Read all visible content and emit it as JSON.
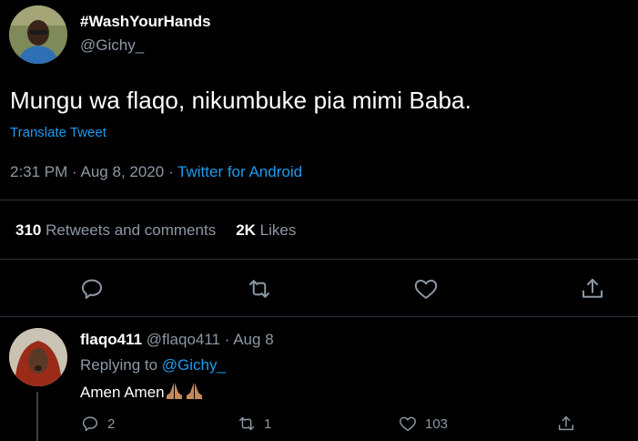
{
  "tweet": {
    "display_name": "#WashYourHands",
    "handle": "@Gichy_",
    "text": "Mungu wa flaqo, nikumbuke pia mimi Baba.",
    "translate_label": "Translate Tweet",
    "time": "2:31 PM",
    "date": "Aug 8, 2020",
    "separator": "·",
    "source": "Twitter for Android",
    "retweets_count": "310",
    "retweets_label": "Retweets and comments",
    "likes_count": "2K",
    "likes_label": "Likes"
  },
  "actions": {
    "reply_icon": "reply-icon",
    "retweet_icon": "retweet-icon",
    "like_icon": "heart-icon",
    "share_icon": "share-icon"
  },
  "reply": {
    "display_name": "flaqo411",
    "handle": "@flaqo411",
    "separator": "·",
    "date": "Aug 8",
    "replying_to_label": "Replying to",
    "replying_to_handle": "@Gichy_",
    "text": "Amen Amen",
    "emoji": "🙏🏽🙏🏽",
    "reply_count": "2",
    "retweet_count": "1",
    "like_count": "103"
  },
  "colors": {
    "background": "#000000",
    "accent": "#1d9bf0",
    "secondary_text": "#8b98a5",
    "divider": "#2f3336"
  }
}
